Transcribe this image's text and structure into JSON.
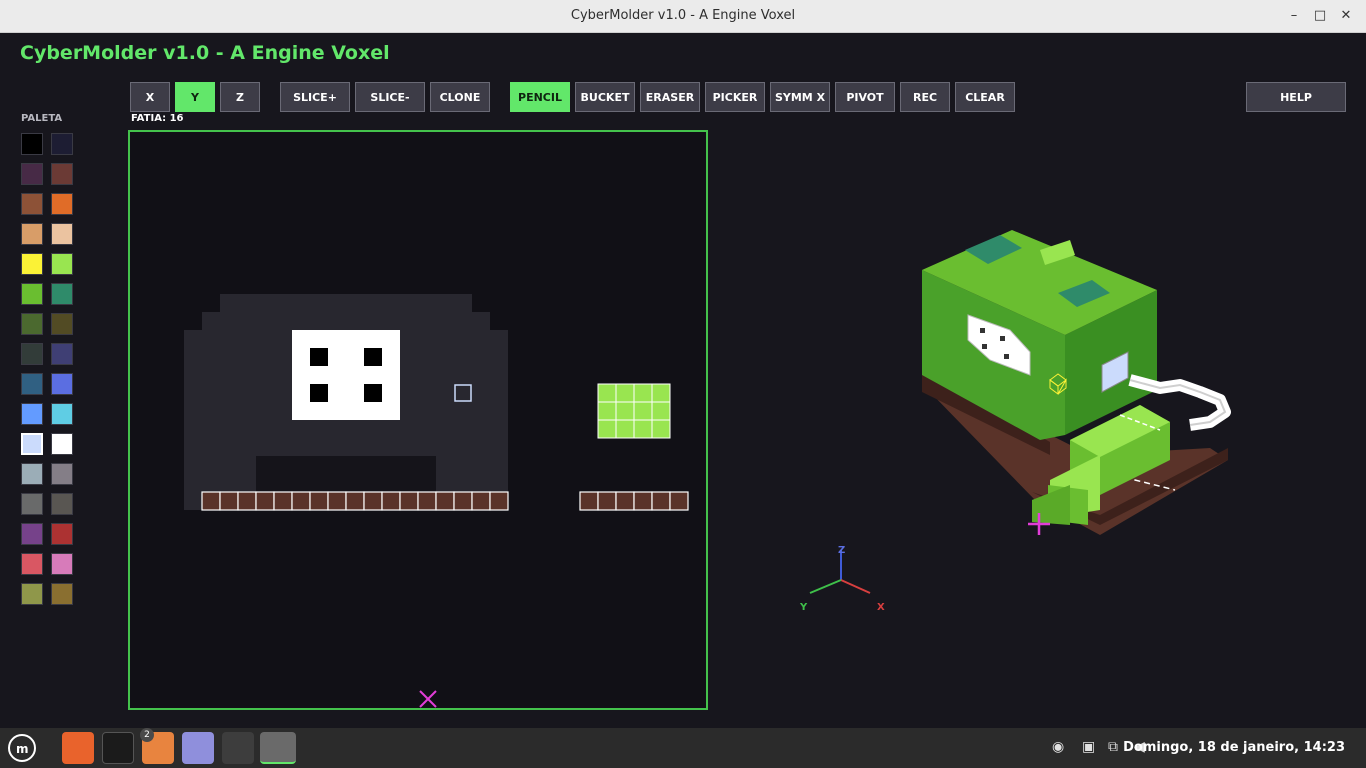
{
  "window": {
    "title": "CyberMolder v1.0 - A Engine Voxel",
    "min_glyph": "–",
    "max_glyph": "□",
    "close_glyph": "✕"
  },
  "app": {
    "title": "CyberMolder v1.0 - A Engine Voxel"
  },
  "toolbar": {
    "axes": [
      "X",
      "Y",
      "Z"
    ],
    "active_axis": "Y",
    "slice_ops": [
      "SLICE+",
      "SLICE-",
      "CLONE"
    ],
    "tools": [
      "PENCIL",
      "BUCKET",
      "ERASER",
      "PICKER",
      "SYMM X",
      "PIVOT",
      "REC",
      "CLEAR"
    ],
    "active_tool": "PENCIL",
    "help": "HELP"
  },
  "slice_label": "FATIA: 16",
  "palette": {
    "label": "PALETA",
    "selected_index": 20,
    "colors": [
      "#000000",
      "#1d1d33",
      "#472a46",
      "#6b3a35",
      "#8d5237",
      "#e06c28",
      "#d89d68",
      "#ebc3a0",
      "#fbf236",
      "#99e550",
      "#6abe30",
      "#2f8b6a",
      "#4b692f",
      "#524b24",
      "#323c39",
      "#3f3f74",
      "#306082",
      "#5b6ee1",
      "#639bff",
      "#5fcde4",
      "#cbdbfc",
      "#ffffff",
      "#9badb7",
      "#847e87",
      "#696a6a",
      "#595652",
      "#76428a",
      "#ac3232",
      "#d95763",
      "#d77bba",
      "#8f974a",
      "#8a6f30"
    ]
  },
  "axis_gizmo": {
    "z": "Z",
    "y": "Y",
    "x": "X"
  },
  "taskbar": {
    "badge": "2",
    "clock": "Domingo, 18 de janeiro, 14:23"
  },
  "accent": "#62e76a"
}
